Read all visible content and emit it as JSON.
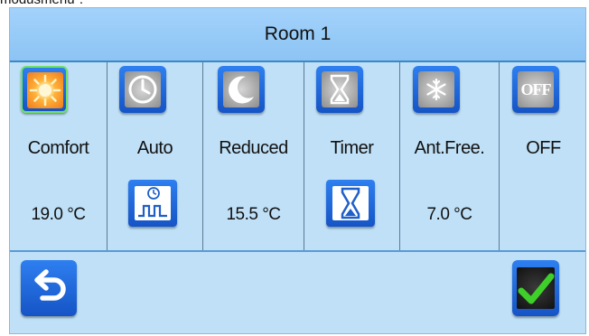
{
  "caption": "modusmenu\".",
  "title": "Room 1",
  "modes": [
    {
      "label": "Comfort",
      "temp": "19.0 °C",
      "icon": "sun-icon"
    },
    {
      "label": "Auto",
      "temp": "",
      "icon": "clock-icon"
    },
    {
      "label": "Reduced",
      "temp": "15.5 °C",
      "icon": "moon-icon"
    },
    {
      "label": "Timer",
      "temp": "",
      "icon": "hourglass-icon"
    },
    {
      "label": "Ant.Free.",
      "temp": "7.0 °C",
      "icon": "snowflake-icon"
    },
    {
      "label": "OFF",
      "temp": "",
      "icon": "off-icon"
    }
  ],
  "off_icon_text": "OFF",
  "selected_mode": "Comfort",
  "colors": {
    "panel": "#bfe0f7",
    "title_bar": "#94c9f6",
    "button": "#1f66dc",
    "check": "#3fcf2a",
    "selected_border": "#6ee06a"
  }
}
